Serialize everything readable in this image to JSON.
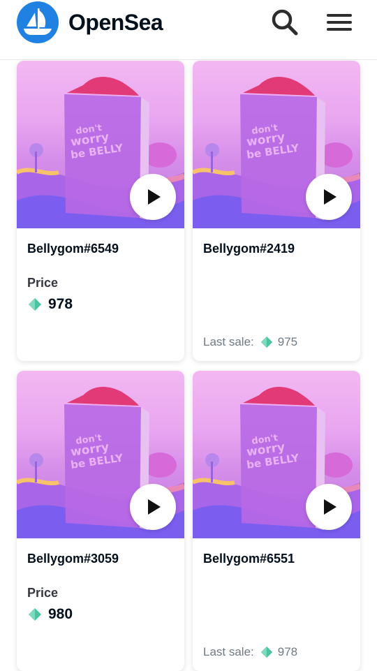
{
  "header": {
    "brand": "OpenSea",
    "search_icon": "search-icon",
    "menu_icon": "hamburger-menu-icon",
    "logo_icon": "opensea-boat-logo",
    "brand_color": "#2081e2"
  },
  "items": [
    {
      "title": "Bellygom#6549",
      "price_label": "Price",
      "price": "978",
      "last_sale_label": "",
      "last_sale": ""
    },
    {
      "title": "Bellygom#2419",
      "price_label": "",
      "price": "",
      "last_sale_label": "Last sale:",
      "last_sale": "975"
    },
    {
      "title": "Bellygom#3059",
      "price_label": "Price",
      "price": "980",
      "last_sale_label": "",
      "last_sale": ""
    },
    {
      "title": "Bellygom#6551",
      "price_label": "",
      "price": "",
      "last_sale_label": "Last sale:",
      "last_sale": "978"
    }
  ],
  "artwork": {
    "box_text_line1": "don't",
    "box_text_line2": "worry",
    "box_text_line3": "be BELLY"
  },
  "currency_icon": "klay-token-icon",
  "play_icon": "play-icon"
}
